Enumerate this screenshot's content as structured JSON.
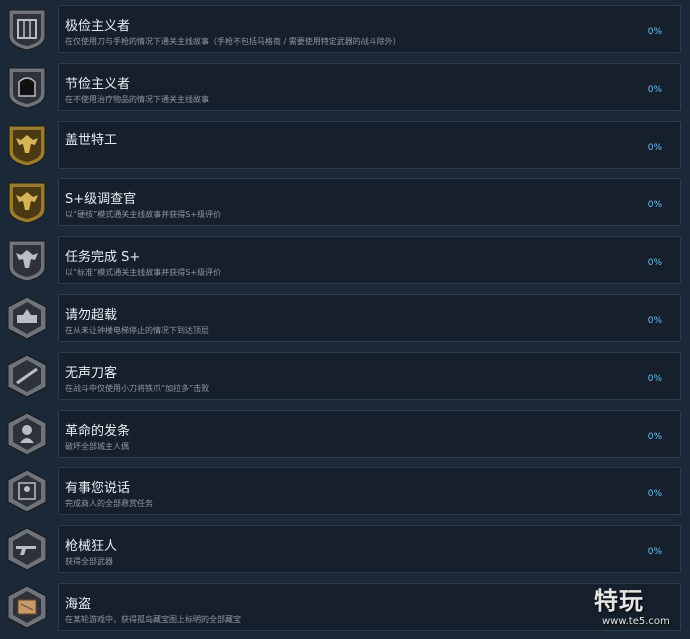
{
  "achievements": [
    {
      "title": "极俭主义者",
      "description": "在仅使用刀与手枪的情况下通关主线故事（手枪不包括马格南 / 需要使用特定武器的战斗除外）",
      "percent": "0%",
      "icon": "silver-gate-badge-icon"
    },
    {
      "title": "节俭主义者",
      "description": "在不使用治疗物品的情况下通关主线故事",
      "percent": "0%",
      "icon": "silver-door-badge-icon"
    },
    {
      "title": "盖世特工",
      "description": "",
      "percent": "0%",
      "icon": "gold-eagle-badge-icon"
    },
    {
      "title": "S+级调查官",
      "description": "以“硬核”模式通关主线故事并获得S+级评价",
      "percent": "0%",
      "icon": "gold-eagle-badge-icon"
    },
    {
      "title": "任务完成 S+",
      "description": "以“标准”模式通关主线故事并获得S+级评价",
      "percent": "0%",
      "icon": "silver-eagle-badge-icon"
    },
    {
      "title": "请勿超载",
      "description": "在从未让钟楼电梯停止的情况下到达顶层",
      "percent": "0%",
      "icon": "clocktower-badge-icon"
    },
    {
      "title": "无声刀客",
      "description": "在战斗中仅使用小刀将铁爪“加拉多”击败",
      "percent": "0%",
      "icon": "knife-badge-icon"
    },
    {
      "title": "革命的发条",
      "description": "破坏全部城主人偶",
      "percent": "0%",
      "icon": "clockwork-doll-badge-icon"
    },
    {
      "title": "有事您说话",
      "description": "完成商人的全部悬赏任务",
      "percent": "0%",
      "icon": "merchant-badge-icon"
    },
    {
      "title": "枪械狂人",
      "description": "获得全部武器",
      "percent": "0%",
      "icon": "gun-badge-icon"
    },
    {
      "title": "海盗",
      "description": "在某轮游戏中，获得孤岛藏宝图上标明的全部藏宝",
      "percent": "",
      "icon": "treasure-map-badge-icon"
    }
  ],
  "colors": {
    "background": "#1b2838",
    "box": "#16202d",
    "border": "#2b3b4d",
    "title": "#e8ecf0",
    "description": "#8f98a0",
    "percent": "#66c0f4",
    "silver": "#8a8f99",
    "gold": "#b8902e"
  },
  "watermark": {
    "main": "特玩",
    "sub": "www.te5.com"
  }
}
